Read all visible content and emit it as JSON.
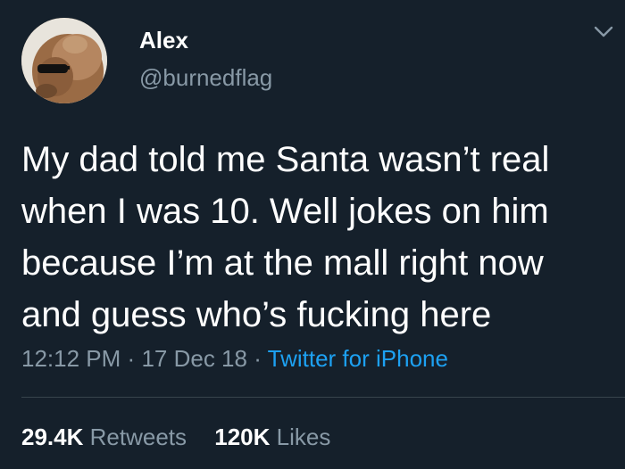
{
  "user": {
    "name": "Alex",
    "handle": "@burnedflag"
  },
  "tweet": {
    "lines": [
      "My dad told me Santa wasn’t real",
      "when I was 10. Well jokes on him",
      "because I’m at the mall right now",
      "and guess who’s fucking here"
    ],
    "time": "12:12 PM",
    "date": "17 Dec 18",
    "separator": "·",
    "source": "Twitter for iPhone"
  },
  "stats": {
    "retweets_count": "29.4K",
    "retweets_label": "Retweets",
    "likes_count": "120K",
    "likes_label": "Likes"
  },
  "icons": {
    "menu": "chevron-down-icon"
  },
  "colors": {
    "background": "#15202b",
    "primary_text": "#ffffff",
    "secondary_text": "#8899a6",
    "link": "#1da1f2",
    "divider": "#38444d"
  }
}
